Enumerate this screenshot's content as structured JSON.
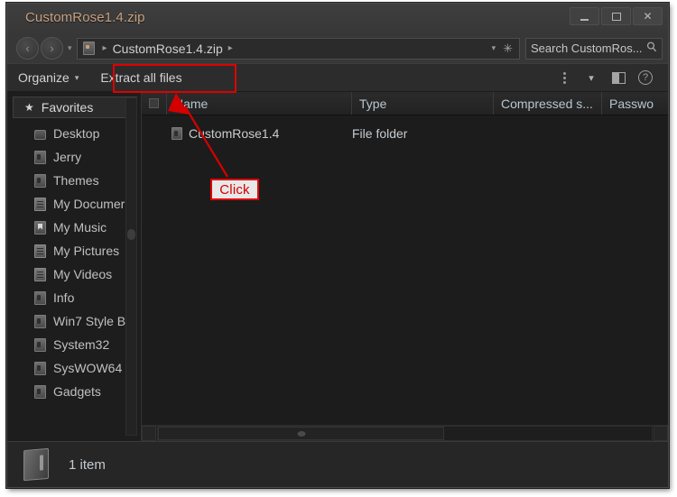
{
  "window": {
    "title": "CustomRose1.4.zip",
    "controls": {
      "minimize": "minimize-button",
      "maximize": "maximize-button",
      "close": "✕"
    }
  },
  "address_bar": {
    "back_glyph": "‹",
    "forward_glyph": "›",
    "history_caret": "▾",
    "breadcrumb": [
      {
        "label": "CustomRose1.4.zip"
      }
    ],
    "crumb_sep": "▸",
    "dropdown_caret": "▾",
    "refresh_glyph": "✳",
    "search": {
      "value": "Search CustomRos...",
      "placeholder": "Search CustomRos...",
      "icon": "🔍"
    }
  },
  "toolbar": {
    "organize_label": "Organize",
    "organize_caret": "▾",
    "extract_label": "Extract all files",
    "more_caret": "▾",
    "help_label": "?"
  },
  "sidebar": {
    "header": {
      "star": "★",
      "label": "Favorites"
    },
    "items": [
      {
        "label": "Desktop",
        "icon": "desktop-icon"
      },
      {
        "label": "Jerry",
        "icon": "folder-icon"
      },
      {
        "label": "Themes",
        "icon": "folder-icon"
      },
      {
        "label": "My Documer",
        "icon": "documents-icon"
      },
      {
        "label": "My Music",
        "icon": "music-icon"
      },
      {
        "label": "My Pictures",
        "icon": "pictures-icon"
      },
      {
        "label": "My Videos",
        "icon": "videos-icon"
      },
      {
        "label": "Info",
        "icon": "folder-icon"
      },
      {
        "label": "Win7 Style B",
        "icon": "folder-icon"
      },
      {
        "label": "System32",
        "icon": "folder-icon"
      },
      {
        "label": "SysWOW64",
        "icon": "folder-icon"
      },
      {
        "label": "Gadgets",
        "icon": "folder-icon"
      }
    ]
  },
  "file_pane": {
    "columns": [
      {
        "label": "Name"
      },
      {
        "label": "Type"
      },
      {
        "label": "Compressed s..."
      },
      {
        "label": "Passwo"
      }
    ],
    "rows": [
      {
        "name": "CustomRose1.4",
        "type": "File folder",
        "compressed": "",
        "password": ""
      }
    ]
  },
  "status_bar": {
    "text": "1 item"
  },
  "annotations": {
    "click_label": "Click",
    "accent_color": "#e00000",
    "label_text_color": "#d40000",
    "label_bg_color": "#e8e8e8"
  }
}
